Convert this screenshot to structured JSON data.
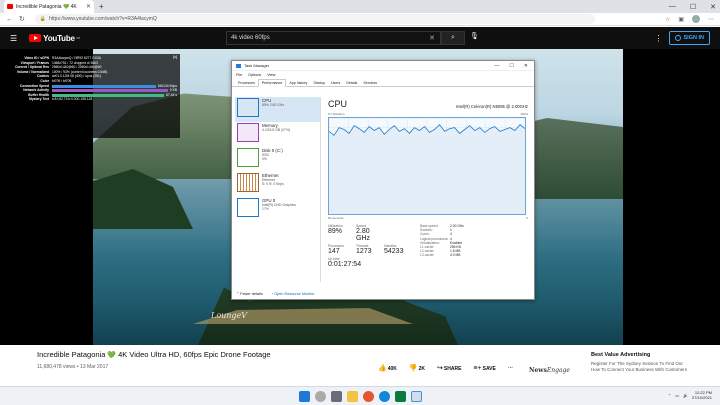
{
  "browser": {
    "tab_title": "Incredible Patagonia 💚 4K",
    "url": "https://www.youtube.com/watch?v=R3A4lacymQ"
  },
  "youtube": {
    "logo_text": "YouTube",
    "region": "GB",
    "search_value": "4k video 60fps",
    "sign_in_label": "SIGN IN"
  },
  "stats": {
    "rows": [
      {
        "k": "Video ID / sCPN",
        "v": "R3A4lacymQ / I3R92 6277 GX3A"
      },
      {
        "k": "Viewport / Frames",
        "v": "1468x751 / 72 dropped of 3663"
      },
      {
        "k": "Current / Optimal Res",
        "v": "2560x1440@60 / 2560x1440@60"
      },
      {
        "k": "Volume / Normalized",
        "v": "100% / 93% (content loudness 0.6dB)"
      },
      {
        "k": "Codecs",
        "v": "av01.0.12M.08 (400) / opus (251)"
      },
      {
        "k": "Color",
        "v": "bt709 / bt709"
      },
      {
        "k": "Connection Speed",
        "v": "166134 Kbps"
      },
      {
        "k": "Network Activity",
        "v": "0 KB"
      },
      {
        "k": "Buffer Health",
        "v": "67.44 s"
      },
      {
        "k": "Mystery Text",
        "v": "s:8 t:62.73 b:0.000-158.128"
      }
    ]
  },
  "video": {
    "watermark": "LoungeV"
  },
  "taskmanager": {
    "title": "Task Manager",
    "menu": [
      "File",
      "Options",
      "View"
    ],
    "tabs": [
      "Processes",
      "Performance",
      "App history",
      "Startup",
      "Users",
      "Details",
      "Services"
    ],
    "side": [
      {
        "name": "CPU",
        "sub1": "89% 2.80 GHz",
        "sub2": ""
      },
      {
        "name": "Memory",
        "sub1": "4.2/15.8 GB (27%)",
        "sub2": ""
      },
      {
        "name": "Disk 0 (C:)",
        "sub1": "SSD",
        "sub2": "0%"
      },
      {
        "name": "Ethernet",
        "sub1": "Ethernet",
        "sub2": "S: 0 R: 0 Kbps"
      },
      {
        "name": "GPU 0",
        "sub1": "Intel(R) UHD Graphics",
        "sub2": "17%"
      }
    ],
    "cpu_heading": "CPU",
    "cpu_model": "Intel(R) Celeron(R) N5095 @ 2.00GHz",
    "graph_label_left": "% Utilization",
    "graph_label_right": "100%",
    "graph_foot_left": "60 seconds",
    "graph_foot_right": "0",
    "utilization_series": [
      86,
      82,
      90,
      88,
      84,
      92,
      89,
      85,
      91,
      87,
      90,
      83,
      88,
      92,
      86,
      89,
      84,
      90,
      87,
      91,
      85,
      88,
      93,
      86,
      89,
      90,
      84,
      88,
      92,
      87,
      90,
      85,
      89,
      91,
      86,
      88,
      90,
      87,
      93,
      89
    ],
    "stat_labels": {
      "util": "Utilization",
      "speed": "Speed",
      "proc": "Processes",
      "threads": "Threads",
      "handles": "Handles",
      "uptime": "Up time"
    },
    "stat_values": {
      "util": "89%",
      "speed": "2.80 GHz",
      "proc": "147",
      "threads": "1273",
      "handles": "54233",
      "uptime": "0:01:27:54"
    },
    "details": [
      {
        "k": "Base speed:",
        "v": "2.00 GHz"
      },
      {
        "k": "Sockets:",
        "v": "1"
      },
      {
        "k": "Cores:",
        "v": "4"
      },
      {
        "k": "Logical processors:",
        "v": "4"
      },
      {
        "k": "Virtualization:",
        "v": "Enabled"
      },
      {
        "k": "L1 cache:",
        "v": "256 KB"
      },
      {
        "k": "L2 cache:",
        "v": "1.5 MB"
      },
      {
        "k": "L3 cache:",
        "v": "4.0 MB"
      }
    ],
    "fewer_details": "Fewer details",
    "open_monitor": "Open Resource Monitor"
  },
  "below": {
    "title_a": "Incredible Patagonia",
    "title_b": "4K Video Ultra HD, 60fps Epic Drone Footage",
    "meta": "11,680,478 views • 13 Mar 2017",
    "like": "40K",
    "dislike": "2K",
    "share": "SHARE",
    "save": "SAVE"
  },
  "ad": {
    "brand_a": "News",
    "brand_b": "Engage",
    "headline": "Best Value Advertising",
    "desc": "Register For The Sydney Session To Find Out How To Connect Your Business With Customers"
  },
  "taskbar": {
    "time": "12:22 PM",
    "date": "27/10/2021"
  }
}
